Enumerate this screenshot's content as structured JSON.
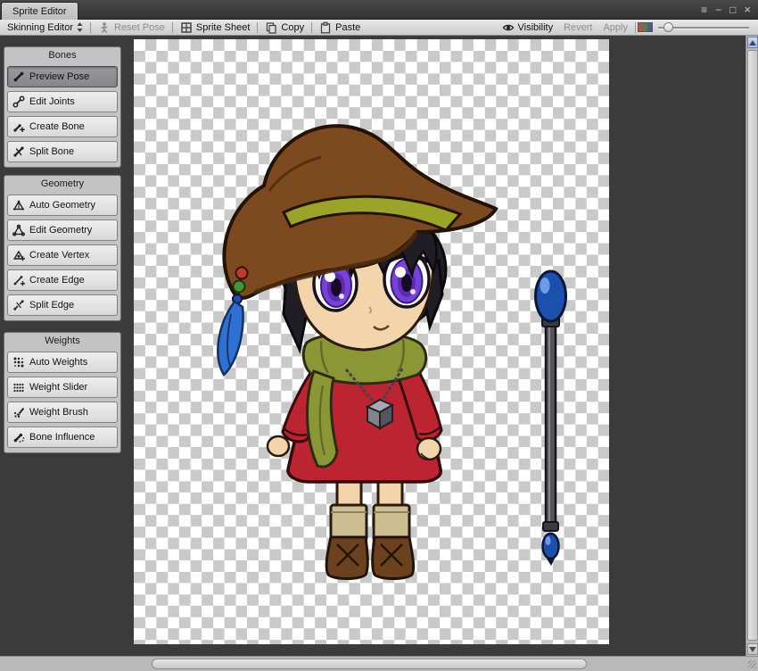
{
  "window": {
    "tab_title": "Sprite Editor",
    "controls": {
      "menu": "≡",
      "minimize": "−",
      "maximize": "□",
      "close": "×"
    }
  },
  "toolbar": {
    "mode_label": "Skinning Editor",
    "reset_pose_label": "Reset Pose",
    "sprite_sheet_label": "Sprite Sheet",
    "copy_label": "Copy",
    "paste_label": "Paste",
    "visibility_label": "Visibility",
    "revert_label": "Revert",
    "apply_label": "Apply"
  },
  "sidebar": {
    "panels": [
      {
        "title": "Bones",
        "items": [
          {
            "label": "Preview Pose",
            "icon": "preview-pose-icon",
            "active": true
          },
          {
            "label": "Edit Joints",
            "icon": "edit-joints-icon",
            "active": false
          },
          {
            "label": "Create Bone",
            "icon": "create-bone-icon",
            "active": false
          },
          {
            "label": "Split Bone",
            "icon": "split-bone-icon",
            "active": false
          }
        ]
      },
      {
        "title": "Geometry",
        "items": [
          {
            "label": "Auto Geometry",
            "icon": "auto-geometry-icon",
            "active": false
          },
          {
            "label": "Edit Geometry",
            "icon": "edit-geometry-icon",
            "active": false
          },
          {
            "label": "Create Vertex",
            "icon": "create-vertex-icon",
            "active": false
          },
          {
            "label": "Create Edge",
            "icon": "create-edge-icon",
            "active": false
          },
          {
            "label": "Split Edge",
            "icon": "split-edge-icon",
            "active": false
          }
        ]
      },
      {
        "title": "Weights",
        "items": [
          {
            "label": "Auto Weights",
            "icon": "auto-weights-icon",
            "active": false
          },
          {
            "label": "Weight Slider",
            "icon": "weight-slider-icon",
            "active": false
          },
          {
            "label": "Weight Brush",
            "icon": "weight-brush-icon",
            "active": false
          },
          {
            "label": "Bone Influence",
            "icon": "bone-influence-icon",
            "active": false
          }
        ]
      }
    ]
  },
  "canvas": {
    "content": "chibi witch character sprite with magic staff on transparency checkerboard",
    "sprite_colors": {
      "hat": "#7c4a1e",
      "hat_band": "#9aa428",
      "hair": "#201e24",
      "skin": "#f3d5ab",
      "eyes": "#7742d6",
      "scarf": "#8b9737",
      "dress": "#bd2431",
      "boots": "#6b421d",
      "staff_orb": "#1c4fae",
      "feather": "#2f70d2"
    }
  },
  "colors": {
    "titlebar_bg": "#3a3a3a",
    "toolbar_bg": "#dedede",
    "viewport_bg": "#3b3b3b",
    "panel_bg": "#c3c3c3",
    "button_bg": "#e3e3e3",
    "button_active_bg": "#8f8f94",
    "checker_light": "#ffffff",
    "checker_dark": "#c9c9c9",
    "disabled_text": "#8d8d8d"
  }
}
